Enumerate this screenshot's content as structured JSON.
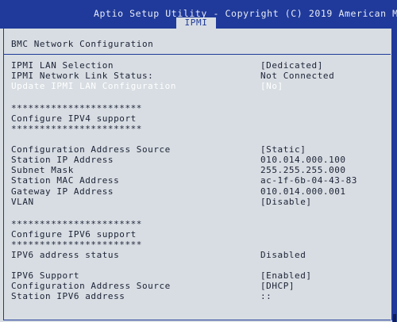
{
  "header": {
    "title": "Aptio Setup Utility - Copyright (C) 2019 American Me",
    "tab": "IPMI"
  },
  "page": {
    "title": "BMC Network Configuration"
  },
  "lan": {
    "selection_label": "IPMI LAN Selection",
    "selection_value": "[Dedicated]",
    "link_status_label": "IPMI Network Link Status:",
    "link_status_value": "Not Connected",
    "update_label": "Update IPMI LAN Configuration",
    "update_value": "[No]"
  },
  "ipv4": {
    "stars_top": "***********************",
    "heading": "Configure IPV4 support",
    "stars_bottom": "***********************",
    "address_source_label": "Configuration Address Source",
    "address_source_value": "[Static]",
    "station_ip_label": "Station IP Address",
    "station_ip_value": "010.014.000.100",
    "subnet_label": "Subnet Mask",
    "subnet_value": "255.255.255.000",
    "mac_label": "Station MAC Address",
    "mac_value": "ac-1f-6b-04-43-83",
    "gateway_label": "Gateway IP Address",
    "gateway_value": "010.014.000.001",
    "vlan_label": "VLAN",
    "vlan_value": "[Disable]"
  },
  "ipv6": {
    "stars_top": "***********************",
    "heading": "Configure IPV6 support",
    "stars_bottom": "***********************",
    "address_status_label": "IPV6 address status",
    "address_status_value": "Disabled",
    "support_label": "IPV6 Support",
    "support_value": "[Enabled]",
    "address_source_label": "Configuration Address Source",
    "address_source_value": "[DHCP]",
    "station_ipv6_label": "Station IPV6 address",
    "station_ipv6_value": "::"
  },
  "colors": {
    "header_bg": "#1f3a9a",
    "panel_bg": "#d7dde2",
    "text": "#1d2236",
    "highlight": "#ffffff"
  }
}
